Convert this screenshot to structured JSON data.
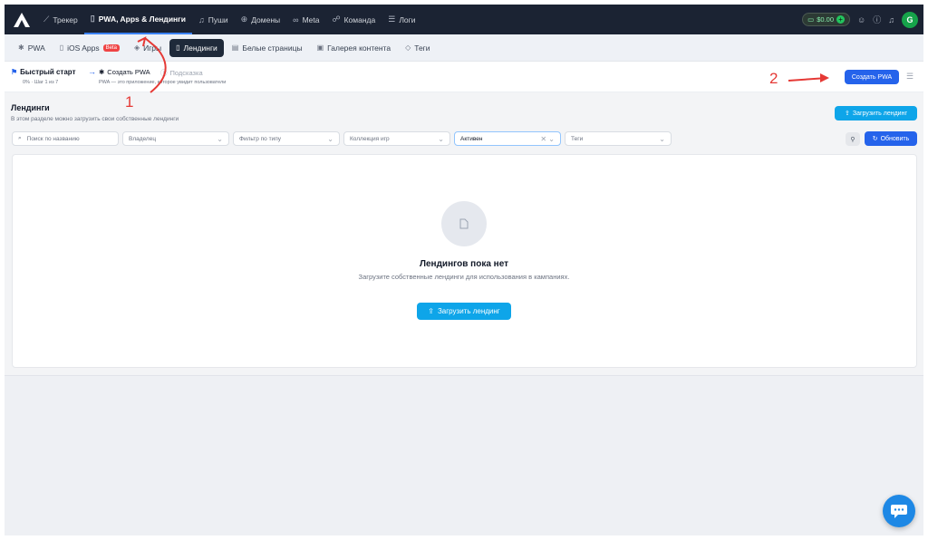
{
  "topnav": {
    "items": [
      {
        "label": "Трекер",
        "icon": "chart-icon"
      },
      {
        "label": "PWA, Apps & Лендинги",
        "icon": "phone-icon"
      },
      {
        "label": "Пуши",
        "icon": "bell-icon"
      },
      {
        "label": "Домены",
        "icon": "globe-icon"
      },
      {
        "label": "Meta",
        "icon": "infinity-icon"
      },
      {
        "label": "Команда",
        "icon": "team-icon"
      },
      {
        "label": "Логи",
        "icon": "list-icon"
      }
    ],
    "balance": "$0.00",
    "avatar_letter": "G"
  },
  "subnav": {
    "items": [
      {
        "label": "PWA",
        "icon": "android-icon"
      },
      {
        "label": "iOS Apps",
        "icon": "phone-icon",
        "badge": "Beta"
      },
      {
        "label": "Игры",
        "icon": "gamepad-icon"
      },
      {
        "label": "Лендинги",
        "icon": "phone-icon"
      },
      {
        "label": "Белые страницы",
        "icon": "page-icon"
      },
      {
        "label": "Галерея контента",
        "icon": "gallery-icon"
      },
      {
        "label": "Теги",
        "icon": "tag-icon"
      }
    ]
  },
  "quickstart": {
    "title": "Быстрый старт",
    "progress": "0% · Шаг 1 из 7",
    "step_label": "Создать PWA",
    "step_desc": "PWA — это приложение, которое увидит пользователи",
    "hint": "Подсказка",
    "create_pwa": "Создать PWA"
  },
  "page": {
    "title": "Лендинги",
    "subtitle": "В этом разделе можно загрузить свои собственные лендинги",
    "upload_button": "Загрузить лендинг"
  },
  "filters": {
    "search_placeholder": "Поиск по названию",
    "owner": "Владелец",
    "type": "Фильтр по типу",
    "collection": "Коллекция игр",
    "status": "Активен",
    "tags": "Теги",
    "refresh": "Обновить"
  },
  "empty": {
    "title": "Лендингов пока нет",
    "text": "Загрузите собственные лендинги для использования в кампаниях.",
    "button": "Загрузить лендинг"
  },
  "annotations": {
    "one": "1",
    "two": "2"
  },
  "colors": {
    "primary": "#2563eb",
    "accent": "#0ea5e9",
    "annotation": "#e53935",
    "nav_bg": "#1b2333"
  }
}
